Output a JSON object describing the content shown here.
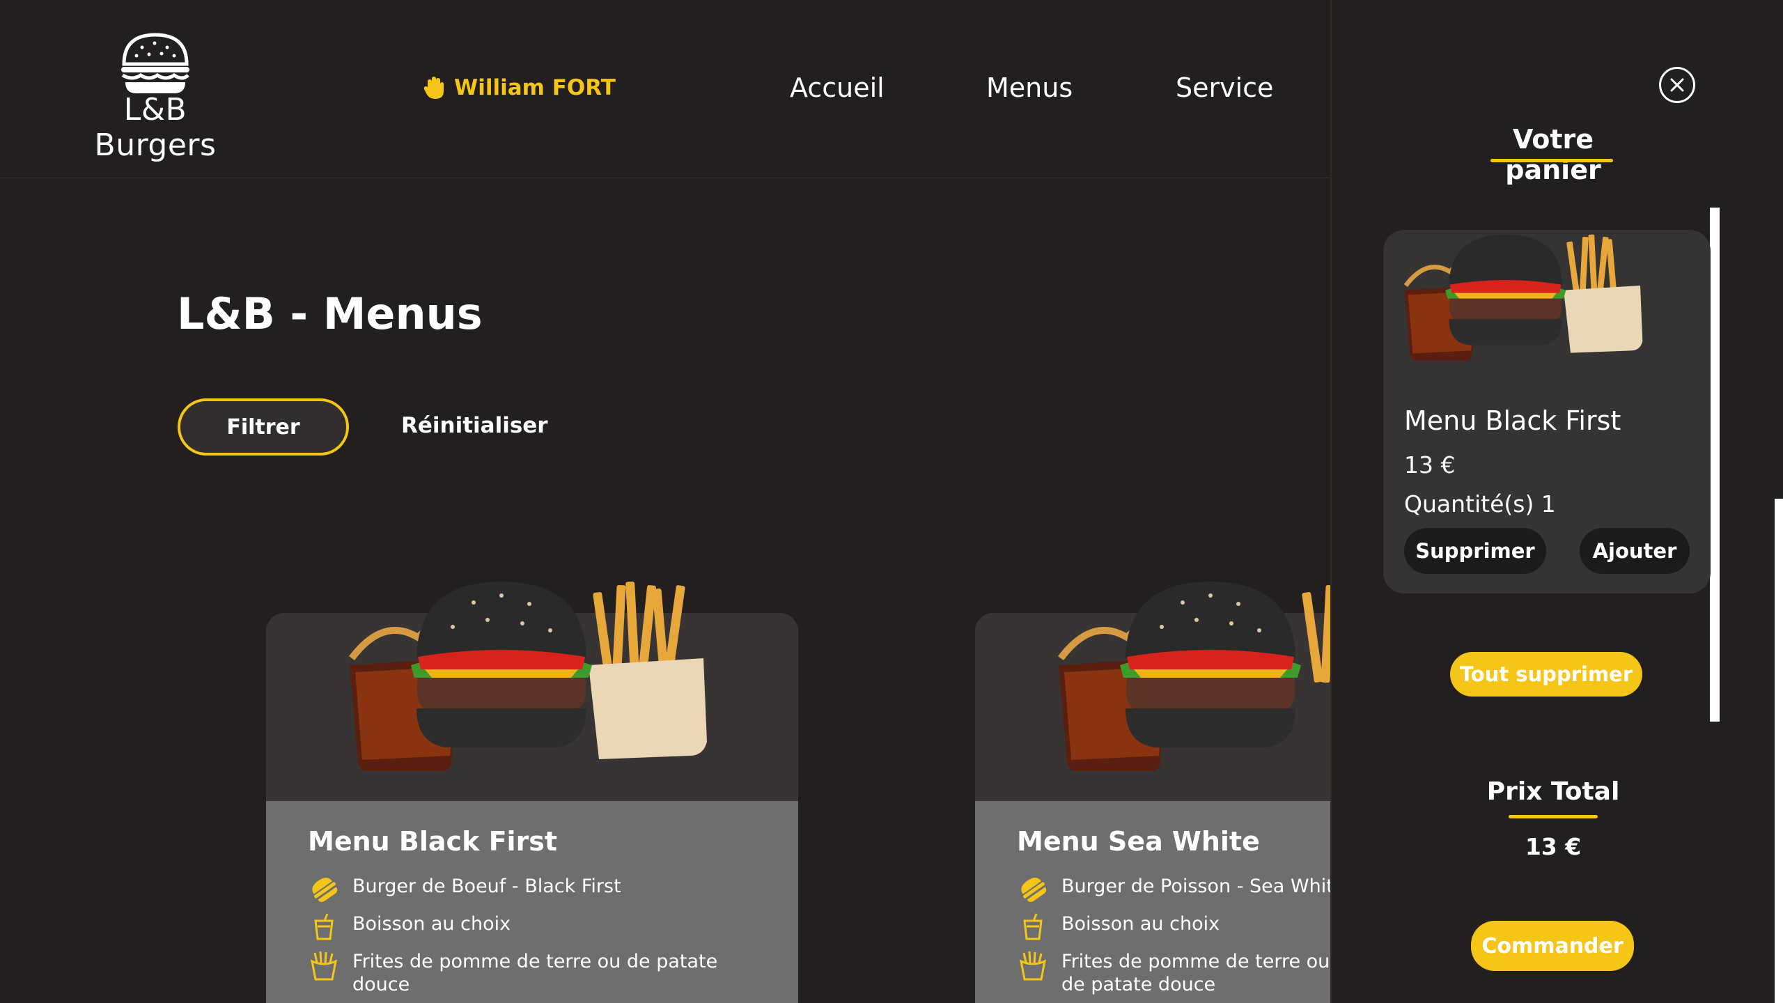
{
  "header": {
    "logo_text": "L&B Burgers",
    "user_name": "William FORT",
    "nav": [
      {
        "label": "Accueil"
      },
      {
        "label": "Menus"
      },
      {
        "label": "Service"
      }
    ]
  },
  "main": {
    "title": "L&B - Menus",
    "filter_label": "Filtrer",
    "reset_label": "Réinitialiser",
    "cards": [
      {
        "title": "Menu Black First",
        "items": [
          {
            "icon": "burger-icon",
            "text": "Burger de Boeuf - Black First"
          },
          {
            "icon": "drink-icon",
            "text": "Boisson au choix"
          },
          {
            "icon": "fries-icon",
            "text": "Frites de pomme de terre ou de patate douce"
          }
        ]
      },
      {
        "title": "Menu Sea White",
        "items": [
          {
            "icon": "burger-icon",
            "text": "Burger de Poisson - Sea White"
          },
          {
            "icon": "drink-icon",
            "text": "Boisson au choix"
          },
          {
            "icon": "fries-icon",
            "text": "Frites de pomme de terre ou de patate douce"
          }
        ]
      }
    ]
  },
  "cart": {
    "title": "Votre panier",
    "item": {
      "name": "Menu Black First",
      "price": "13 €",
      "quantity": "Quantité(s) 1",
      "remove_label": "Supprimer",
      "add_label": "Ajouter"
    },
    "clear_label": "Tout supprimer",
    "total_title": "Prix Total",
    "total_value": "13 €",
    "order_label": "Commander"
  },
  "colors": {
    "accent": "#f5c518",
    "background": "#221f1e",
    "card_body": "#6e6e6e",
    "card_image_bg": "#373433"
  }
}
